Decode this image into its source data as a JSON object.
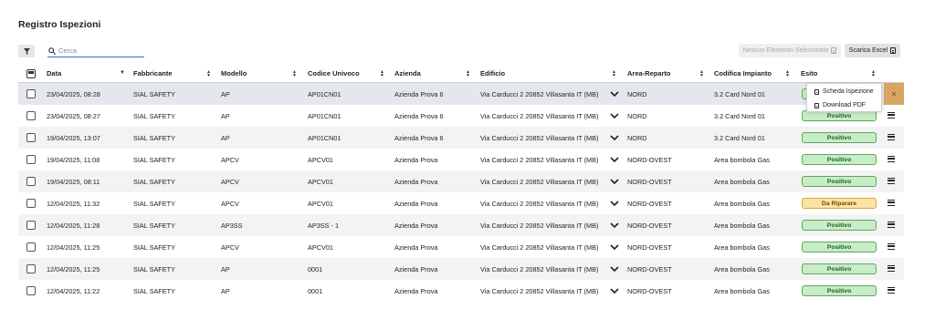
{
  "page": {
    "title": "Registro Ispezioni"
  },
  "toolbar": {
    "search_placeholder": "Cerca",
    "selected_label": "Nessun Elemento Selezionato",
    "excel_label": "Scarica Excel"
  },
  "columns": [
    "Data",
    "Fabbricante",
    "Modello",
    "Codice Univoco",
    "Azienda",
    "Edificio",
    "Area-Reparto",
    "Codifica Impianto",
    "Esito"
  ],
  "rows": [
    {
      "data": "23/04/2025, 08:28",
      "fabbricante": "SIAL SAFETY",
      "modello": "AP",
      "codice": "AP01CN01",
      "azienda": "Azienda Prova 6",
      "edificio": "Via Carducci 2 20852 Villasanta IT (MB)",
      "area": "NORD",
      "codifica": "3.2 Card Nord 01",
      "esito": "Positivo",
      "status": "ok"
    },
    {
      "data": "23/04/2025, 08:27",
      "fabbricante": "SIAL SAFETY",
      "modello": "AP",
      "codice": "AP01CN01",
      "azienda": "Azienda Prova 6",
      "edificio": "Via Carducci 2 20852 Villasanta IT (MB)",
      "area": "NORD",
      "codifica": "3.2 Card Nord 01",
      "esito": "Positivo",
      "status": "ok"
    },
    {
      "data": "19/04/2025, 13:07",
      "fabbricante": "SIAL SAFETY",
      "modello": "AP",
      "codice": "AP01CN01",
      "azienda": "Azienda Prova 6",
      "edificio": "Via Carducci 2 20852 Villasanta IT (MB)",
      "area": "NORD",
      "codifica": "3.2 Card Nord 01",
      "esito": "Positivo",
      "status": "ok"
    },
    {
      "data": "19/04/2025, 11:08",
      "fabbricante": "SIAL SAFETY",
      "modello": "APCV",
      "codice": "APCV01",
      "azienda": "Azienda Prova",
      "edificio": "Via Carducci 2 20852 Villasanta IT (MB)",
      "area": "NORD-OVEST",
      "codifica": "Area bombola Gas",
      "esito": "Positivo",
      "status": "ok"
    },
    {
      "data": "19/04/2025, 08:11",
      "fabbricante": "SIAL SAFETY",
      "modello": "APCV",
      "codice": "APCV01",
      "azienda": "Azienda Prova",
      "edificio": "Via Carducci 2 20852 Villasanta IT (MB)",
      "area": "NORD-OVEST",
      "codifica": "Area bombola Gas",
      "esito": "Positivo",
      "status": "ok"
    },
    {
      "data": "12/04/2025, 11:32",
      "fabbricante": "SIAL SAFETY",
      "modello": "APCV",
      "codice": "APCV01",
      "azienda": "Azienda Prova",
      "edificio": "Via Carducci 2 20852 Villasanta IT (MB)",
      "area": "NORD-OVEST",
      "codifica": "Area bombola Gas",
      "esito": "Da Riparare",
      "status": "warn"
    },
    {
      "data": "12/04/2025, 11:28",
      "fabbricante": "SIAL SAFETY",
      "modello": "AP3SS",
      "codice": "AP3SS - 1",
      "azienda": "Azienda Prova",
      "edificio": "Via Carducci 2 20852 Villasanta IT (MB)",
      "area": "NORD-OVEST",
      "codifica": "Area bombola Gas",
      "esito": "Positivo",
      "status": "ok"
    },
    {
      "data": "12/04/2025, 11:25",
      "fabbricante": "SIAL SAFETY",
      "modello": "APCV",
      "codice": "APCV01",
      "azienda": "Azienda Prova",
      "edificio": "Via Carducci 2 20852 Villasanta IT (MB)",
      "area": "NORD-OVEST",
      "codifica": "Area bombola Gas",
      "esito": "Positivo",
      "status": "ok"
    },
    {
      "data": "12/04/2025, 11:25",
      "fabbricante": "SIAL SAFETY",
      "modello": "AP",
      "codice": "0001",
      "azienda": "Azienda Prova",
      "edificio": "Via Carducci 2 20852 Villasanta IT (MB)",
      "area": "NORD-OVEST",
      "codifica": "Area bombola Gas",
      "esito": "Positivo",
      "status": "ok"
    },
    {
      "data": "12/04/2025, 11:22",
      "fabbricante": "SIAL SAFETY",
      "modello": "AP",
      "codice": "0001",
      "azienda": "Azienda Prova",
      "edificio": "Via Carducci 2 20852 Villasanta IT (MB)",
      "area": "NORD-OVEST",
      "codifica": "Area bombola Gas",
      "esito": "Positivo",
      "status": "ok"
    }
  ],
  "row_menu": {
    "items": [
      "Scheda Ispezione",
      "Download PDF"
    ],
    "close_symbol": "×"
  },
  "colors": {
    "accent": "#2f6fd6",
    "positive_bg": "#c8ecc8",
    "warning_bg": "#fbe3a8",
    "menu_open": "#d9a565"
  }
}
